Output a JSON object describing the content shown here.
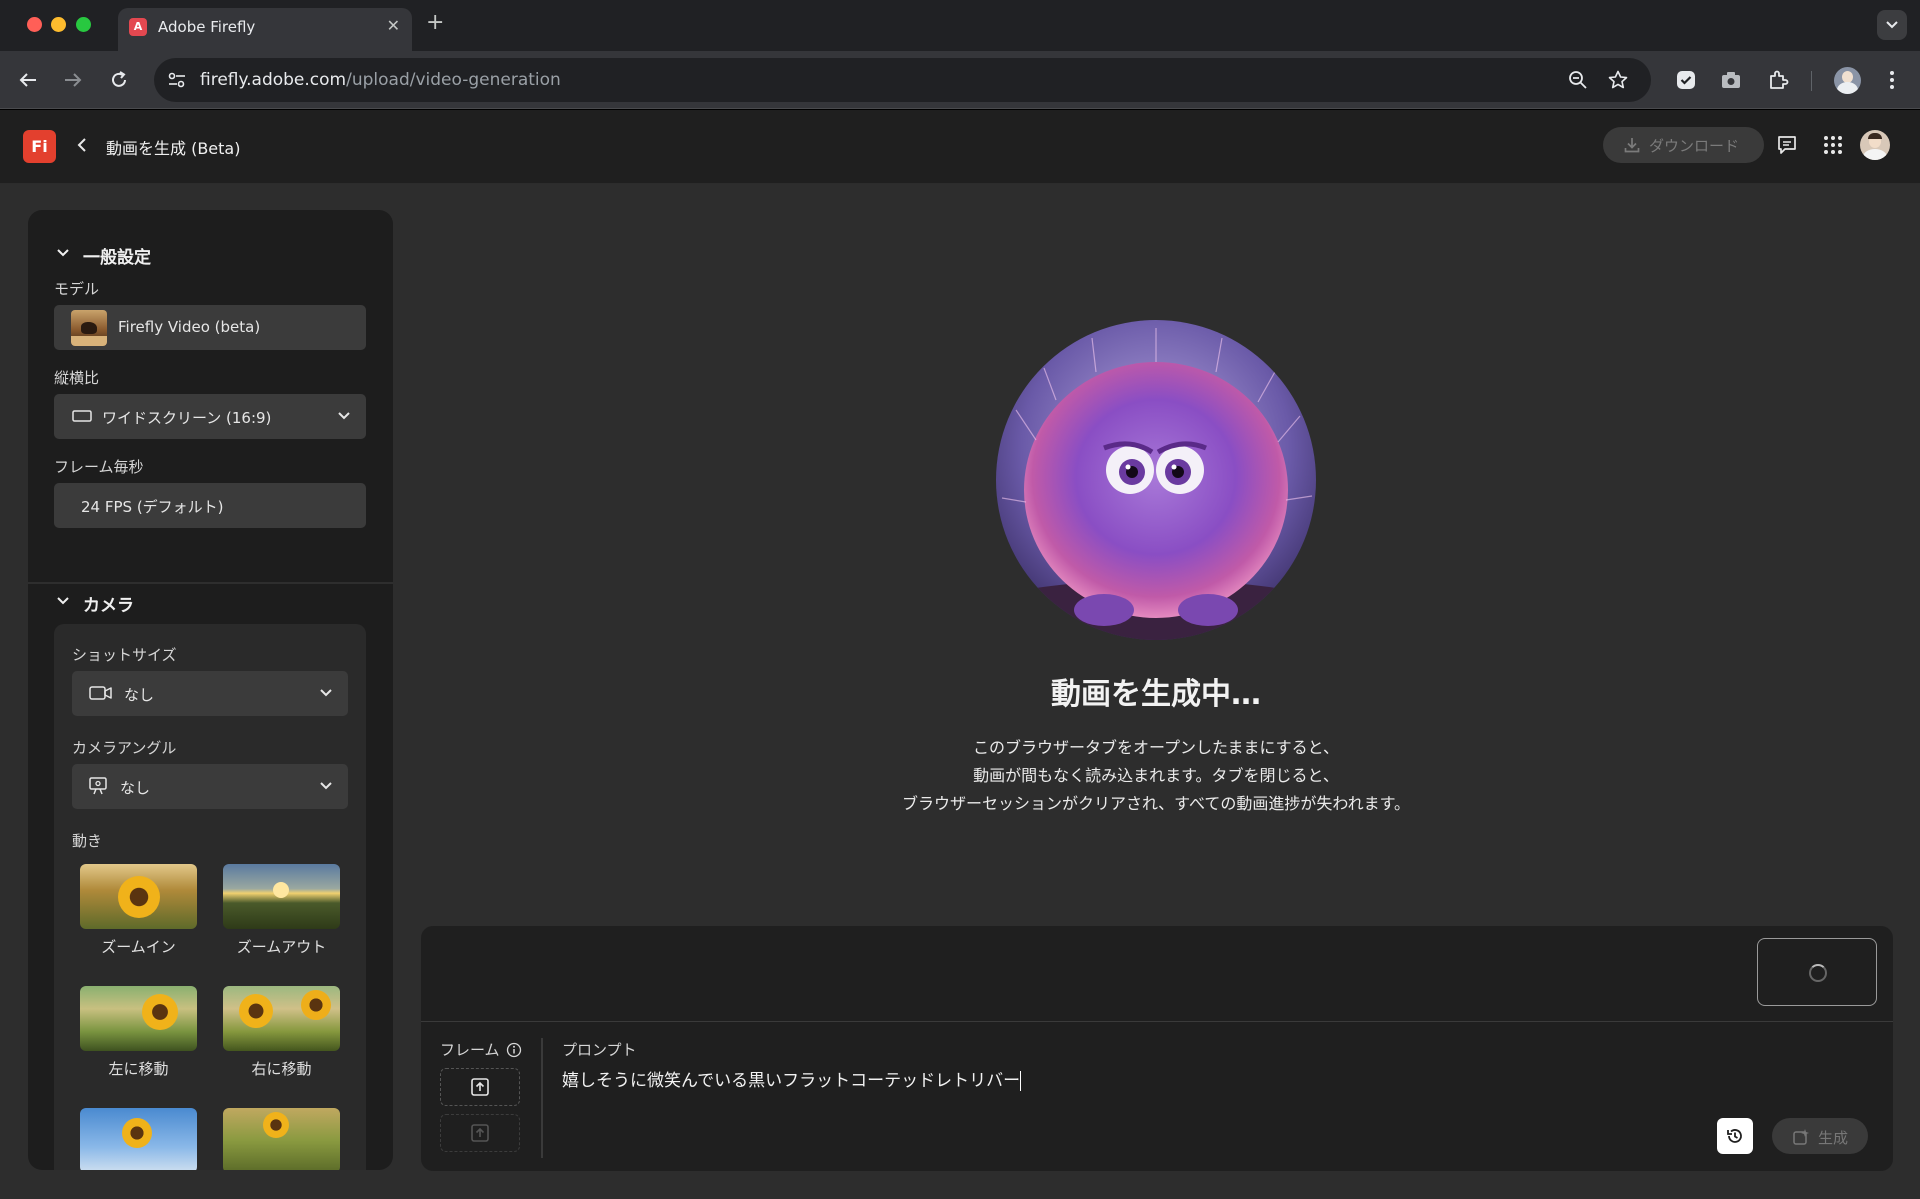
{
  "browser": {
    "tab_title": "Adobe Firefly",
    "tab_favicon_letter": "A",
    "url_host": "firefly.adobe.com",
    "url_path": "/upload/video-generation"
  },
  "app": {
    "logo_text": "Fi",
    "title": "動画を生成 (Beta)",
    "download_label": "ダウンロード"
  },
  "general": {
    "header": "一般設定",
    "model_label": "モデル",
    "model_value": "Firefly Video (beta)",
    "aspect_label": "縦横比",
    "aspect_value": "ワイドスクリーン (16:9)",
    "fps_label": "フレーム毎秒",
    "fps_value": "24 FPS (デフォルト)"
  },
  "camera": {
    "header": "カメラ",
    "shot_label": "ショットサイズ",
    "shot_value": "なし",
    "angle_label": "カメラアングル",
    "angle_value": "なし",
    "motion_label": "動き",
    "motions": [
      {
        "label": "ズームイン"
      },
      {
        "label": "ズームアウト"
      },
      {
        "label": "左に移動"
      },
      {
        "label": "右に移動"
      }
    ]
  },
  "status": {
    "title": "動画を生成中…",
    "desc_line1": "このブラウザータブをオープンしたままにすると、",
    "desc_line2": "動画が間もなく読み込まれます。タブを閉じると、",
    "desc_line3": "ブラウザーセッションがクリアされ、すべての動画進捗が失われます。"
  },
  "prompt": {
    "frame_label": "フレーム",
    "prompt_label": "プロンプト",
    "prompt_value": "嬉しそうに微笑んでいる黒いフラットコーテッドレトリバー",
    "generate_label": "生成"
  }
}
